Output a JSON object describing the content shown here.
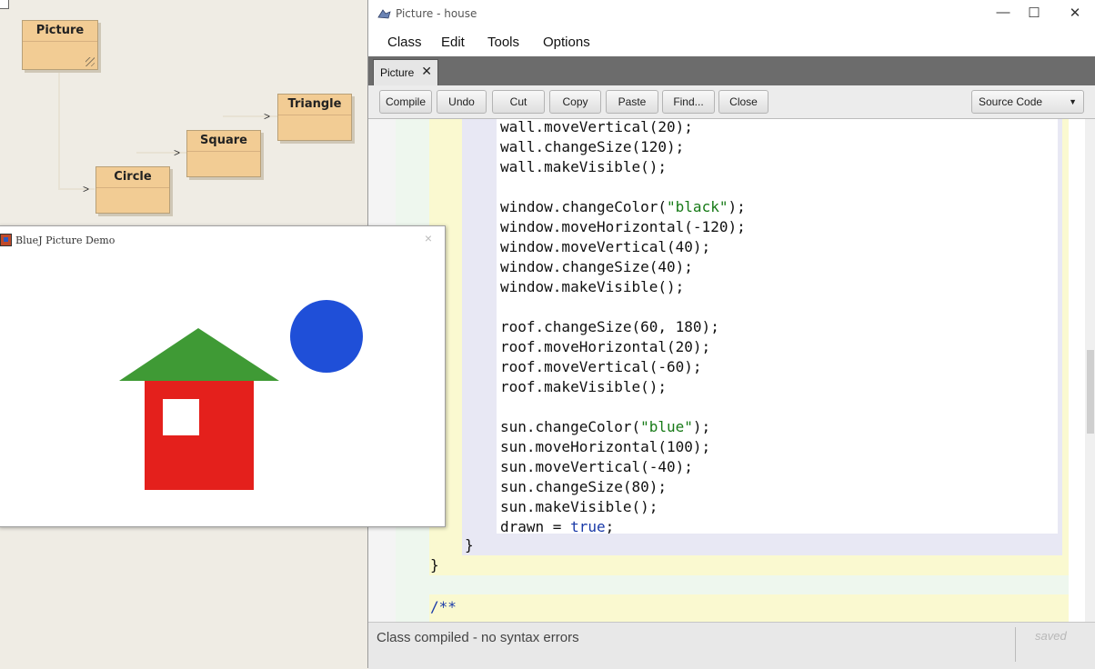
{
  "diagram": {
    "classes": [
      {
        "name": "Picture"
      },
      {
        "name": "Triangle"
      },
      {
        "name": "Square"
      },
      {
        "name": "Circle"
      }
    ],
    "arrow_glyph": ">"
  },
  "demo_window": {
    "title": "BlueJ Picture Demo",
    "close_glyph": "×",
    "colors": {
      "roof": "#3f9a35",
      "wall": "#e4201c",
      "window": "#ffffff",
      "sun": "#1f4fd8"
    }
  },
  "editor": {
    "window_title": "Picture - house",
    "minimize_glyph": "—",
    "maximize_glyph": "☐",
    "close_glyph": "✕",
    "menus": [
      "Class",
      "Edit",
      "Tools",
      "Options"
    ],
    "tab": {
      "label": "Picture",
      "close_glyph": "✕"
    },
    "toolbar": [
      "Compile",
      "Undo",
      "Cut",
      "Copy",
      "Paste",
      "Find...",
      "Close"
    ],
    "view_selector": "Source Code",
    "code_lines": [
      {
        "t": "wall.moveVertical(20);"
      },
      {
        "t": "wall.changeSize(120);"
      },
      {
        "t": "wall.makeVisible();"
      },
      {
        "t": ""
      },
      {
        "pre": "window.changeColor(",
        "str": "\"black\"",
        "post": ");"
      },
      {
        "t": "window.moveHorizontal(-120);"
      },
      {
        "t": "window.moveVertical(40);"
      },
      {
        "t": "window.changeSize(40);"
      },
      {
        "t": "window.makeVisible();"
      },
      {
        "t": ""
      },
      {
        "t": "roof.changeSize(60, 180);"
      },
      {
        "t": "roof.moveHorizontal(20);"
      },
      {
        "t": "roof.moveVertical(-60);"
      },
      {
        "t": "roof.makeVisible();"
      },
      {
        "t": ""
      },
      {
        "pre": "sun.changeColor(",
        "str": "\"blue\"",
        "post": ");"
      },
      {
        "t": "sun.moveHorizontal(100);"
      },
      {
        "t": "sun.moveVertical(-40);"
      },
      {
        "t": "sun.changeSize(80);"
      },
      {
        "t": "sun.makeVisible();"
      },
      {
        "pre": "drawn = ",
        "kw": "true",
        "post": ";"
      }
    ],
    "closing_brace_inner": "}",
    "closing_brace_outer": "}",
    "doc_comment_start": "/**",
    "status_message": "Class compiled - no syntax errors",
    "saved_label": "saved"
  }
}
